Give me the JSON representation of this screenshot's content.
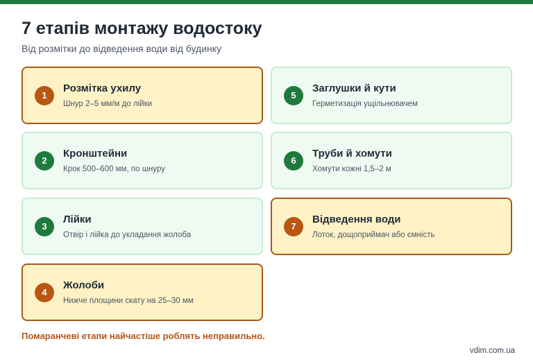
{
  "header": {
    "title": "7 етапів монтажу водостоку",
    "subtitle": "Від розмітки до відведення води від будинку"
  },
  "steps": [
    {
      "number": "1",
      "title": "Розмітка ухилу",
      "description": "Шнур 2–5 мм/м до лійки",
      "highlighted": true
    },
    {
      "number": "2",
      "title": "Кронштейни",
      "description": "Крок 500–600 мм, по шнуру",
      "highlighted": false
    },
    {
      "number": "3",
      "title": "Лійки",
      "description": "Отвір і лійка до укладання жолоба",
      "highlighted": false
    },
    {
      "number": "4",
      "title": "Жолоби",
      "description": "Нижче площини скату на 25–30 мм",
      "highlighted": true
    },
    {
      "number": "5",
      "title": "Заглушки й кути",
      "description": "Герметизація ущільнювачем",
      "highlighted": false
    },
    {
      "number": "6",
      "title": "Труби й хомути",
      "description": "Хомути кожні 1,5–2 м",
      "highlighted": false
    },
    {
      "number": "7",
      "title": "Відведення води",
      "description": "Лоток, дощоприймач або ємність",
      "highlighted": true
    }
  ],
  "footnote": "Помаранчеві етапи найчастіше роблять неправильно.",
  "source": "vdim.com.ua",
  "colors": {
    "brand_green": "#1f7a3e",
    "highlight_orange": "#b85612",
    "highlight_fill": "#fff2c6",
    "normal_fill": "#effbf2"
  }
}
